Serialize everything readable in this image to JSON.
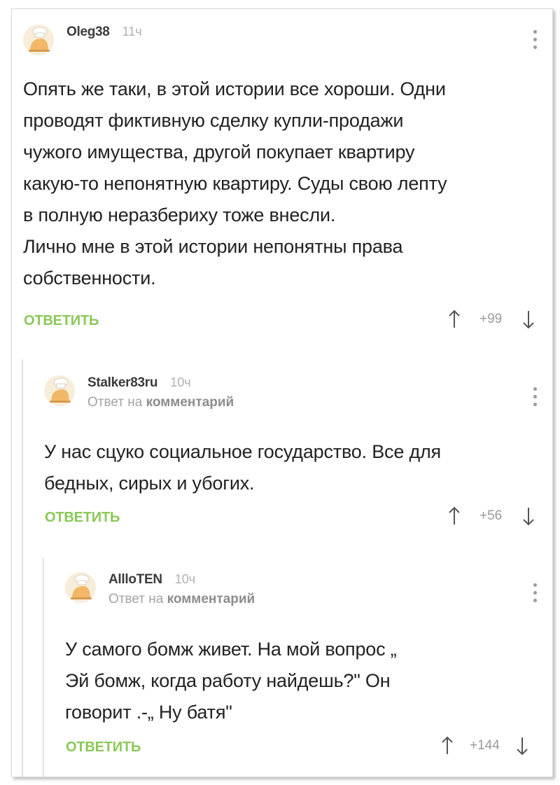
{
  "colors": {
    "accent_green": "#8ac858",
    "meta_gray": "#a3a3a3",
    "text": "#222222"
  },
  "comments": [
    {
      "username": "Oleg38",
      "time": "11ч",
      "reply_to": null,
      "text": "Опять же таки, в этой истории все хороши. Одни\nпроводят фиктивную сделку купли-продажи\nчужого имущества, другой покупает квартиру\nкакую-то непонятную квартиру. Суды свою лепту\nв полную неразбериху тоже внесли.\nЛично мне в этой истории непонятны права\nсобственности.",
      "reply_label": "ОТВЕТИТЬ",
      "score": "+99",
      "icons": {
        "avatar": "chef-avatar-icon",
        "menu": "kebab-menu-icon",
        "up": "arrow-up-icon",
        "down": "arrow-down-icon"
      }
    },
    {
      "username": "Stalker83ru",
      "time": "10ч",
      "reply_to": {
        "prefix": "Ответ на",
        "target": "комментарий"
      },
      "text": "У нас сцуко социальное государство. Все для\nбедных, сирых и убогих.",
      "reply_label": "ОТВЕТИТЬ",
      "score": "+56",
      "icons": {
        "avatar": "chef-avatar-icon",
        "menu": "kebab-menu-icon",
        "up": "arrow-up-icon",
        "down": "arrow-down-icon"
      }
    },
    {
      "username": "AllloTEN",
      "time": "10ч",
      "reply_to": {
        "prefix": "Ответ на",
        "target": "комментарий"
      },
      "text": "У самого бомж живет. На мой вопрос „\nЭй бомж, когда работу найдешь?\" Он\nговорит .-„ Ну батя\"",
      "reply_label": "ОТВЕТИТЬ",
      "score": "+144",
      "icons": {
        "avatar": "chef-avatar-icon",
        "menu": "kebab-menu-icon",
        "up": "arrow-up-icon",
        "down": "arrow-down-icon"
      }
    }
  ]
}
